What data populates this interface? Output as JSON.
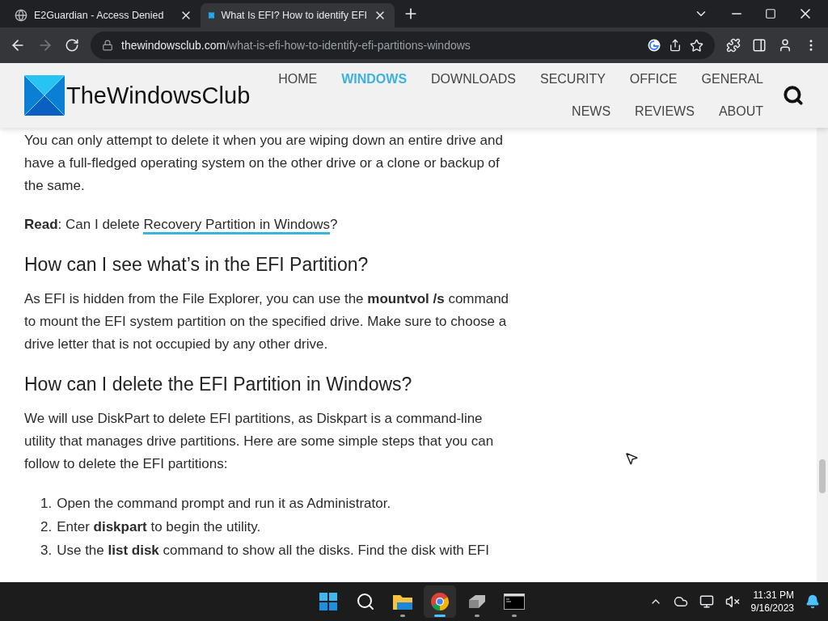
{
  "tabs": [
    {
      "title": "E2Guardian - Access Denied",
      "kind": "globe",
      "selected": false
    },
    {
      "title": "What Is EFI? How to identify EFI",
      "kind": "site",
      "selected": true
    }
  ],
  "address": {
    "domain": "thewindowsclub.com",
    "path": "/what-is-efi-how-to-identify-efi-partitions-windows"
  },
  "site": {
    "logo_text": "TheWindowsClub",
    "nav": [
      {
        "label": "HOME",
        "selected": false
      },
      {
        "label": "WINDOWS",
        "selected": true
      },
      {
        "label": "DOWNLOADS",
        "selected": false
      },
      {
        "label": "SECURITY",
        "selected": false
      },
      {
        "label": "OFFICE",
        "selected": false
      },
      {
        "label": "GENERAL",
        "selected": false
      },
      {
        "label": "NEWS",
        "selected": false
      },
      {
        "label": "REVIEWS",
        "selected": false
      },
      {
        "label": "ABOUT",
        "selected": false
      }
    ]
  },
  "article": [
    {
      "kind": "paragraph",
      "text": "You can only attempt to delete it when you are wiping down an entire drive and have a full-fledged operating system on the other drive or a clone or backup of the same."
    },
    {
      "kind": "read",
      "prefix": "**Read**: Can I delete ",
      "link": "Recovery Partition in Windows",
      "suffix": "?"
    },
    {
      "kind": "heading",
      "text": "How can I see what’s in the EFI Partition?"
    },
    {
      "kind": "paragraph",
      "text": "As EFI is hidden from the File Explorer, you can use the **mountvol /s** command to mount the EFI system partition on the specified drive. Make sure to choose a drive letter that is not occupied by any other drive."
    },
    {
      "kind": "heading",
      "text": "How can I delete the EFI Partition in Windows?"
    },
    {
      "kind": "paragraph",
      "text": "We will use DiskPart to delete EFI partitions, as Diskpart is a command-line utility that manages drive partitions. Here are some simple steps that you can follow to delete the EFI partitions:"
    },
    {
      "kind": "list",
      "items": [
        {
          "number": "1.",
          "text": "Open the command prompt and run it as Administrator."
        },
        {
          "number": "2.",
          "text": "Enter **diskpart** to begin the utility."
        },
        {
          "number": "3.",
          "text": "Use the **list disk** command to show all the disks. Find the disk with EFI"
        }
      ]
    }
  ],
  "taskbar": {
    "apps": [
      {
        "kind": "start",
        "selected": false
      },
      {
        "kind": "search",
        "selected": false
      },
      {
        "kind": "folder",
        "selected": false,
        "running": true
      },
      {
        "kind": "chrome",
        "selected": true,
        "running": true
      },
      {
        "kind": "drive",
        "selected": false,
        "running": true
      },
      {
        "kind": "terminal",
        "selected": false,
        "running": true
      }
    ],
    "time": "11:31 PM",
    "date": "9/16/2023"
  }
}
